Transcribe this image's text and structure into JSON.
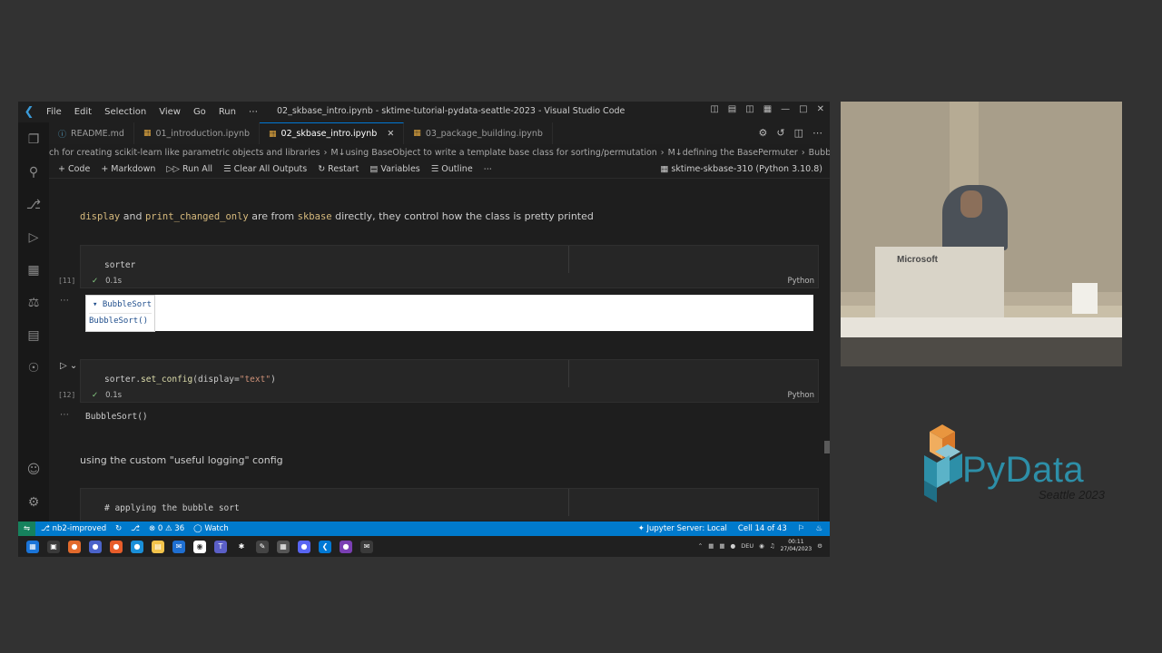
{
  "titlebar": {
    "menu": [
      "File",
      "Edit",
      "Selection",
      "View",
      "Go",
      "Run",
      "⋯"
    ],
    "title": "02_skbase_intro.ipynb - sktime-tutorial-pydata-seattle-2023 - Visual Studio Code"
  },
  "tabs": [
    {
      "label": "README.md",
      "active": false
    },
    {
      "label": "01_introduction.ipynb",
      "active": false
    },
    {
      "label": "02_skbase_intro.ipynb",
      "active": true
    },
    {
      "label": "03_package_building.ipynb",
      "active": false
    }
  ],
  "breadcrumb": [
    "ch for creating scikit-learn like parametric objects and libraries",
    "M↓using BaseObject to write a template base class for sorting/permutation",
    "M↓defining the BasePermuter",
    "BubbleSort().get_tag"
  ],
  "toolbar": {
    "code": "Code",
    "markdown": "Markdown",
    "run_all": "Run All",
    "clear_all": "Clear All Outputs",
    "restart": "Restart",
    "variables": "Variables",
    "outline": "Outline",
    "more": "⋯",
    "kernel": "sktime-skbase-310 (Python 3.10.8)"
  },
  "notebook": {
    "md1": {
      "code1": "display",
      "and": " and ",
      "code2": "print_changed_only",
      "mid": " are from ",
      "code3": "skbase",
      "rest": " directly, they control how the class is pretty printed"
    },
    "cell11": {
      "code": "sorter",
      "count": "[11]",
      "time": "0.1s",
      "lang": "Python",
      "out_header": "▾ BubbleSort",
      "out_body": "BubbleSort()"
    },
    "cell12": {
      "code_obj": "sorter.",
      "code_fn": "set_config",
      "code_args_open": "(display=",
      "code_str": "\"text\"",
      "code_close": ")",
      "count": "[12]",
      "time": "0.1s",
      "lang": "Python",
      "output": "BubbleSort()"
    },
    "md2": "using the custom \"useful logging\" config",
    "cell13": {
      "code": "# applying the bubble sort"
    }
  },
  "statusbar": {
    "branch": "nb2-improved",
    "errors": "0",
    "warnings": "36",
    "watch": "Watch",
    "jupyter": "Jupyter Server: Local",
    "cell": "Cell 14 of 43"
  },
  "tray": {
    "lang": "DEU",
    "time": "00:11",
    "date": "27/04/2023"
  },
  "camera": {
    "podium_label": "Microsoft"
  },
  "logo": {
    "text": "PyData",
    "subtitle": "Seattle 2023",
    "colors": {
      "cube_top": "#e9963f",
      "cube_left": "#2d8fa8",
      "cube_right": "#5bb3c8"
    }
  }
}
